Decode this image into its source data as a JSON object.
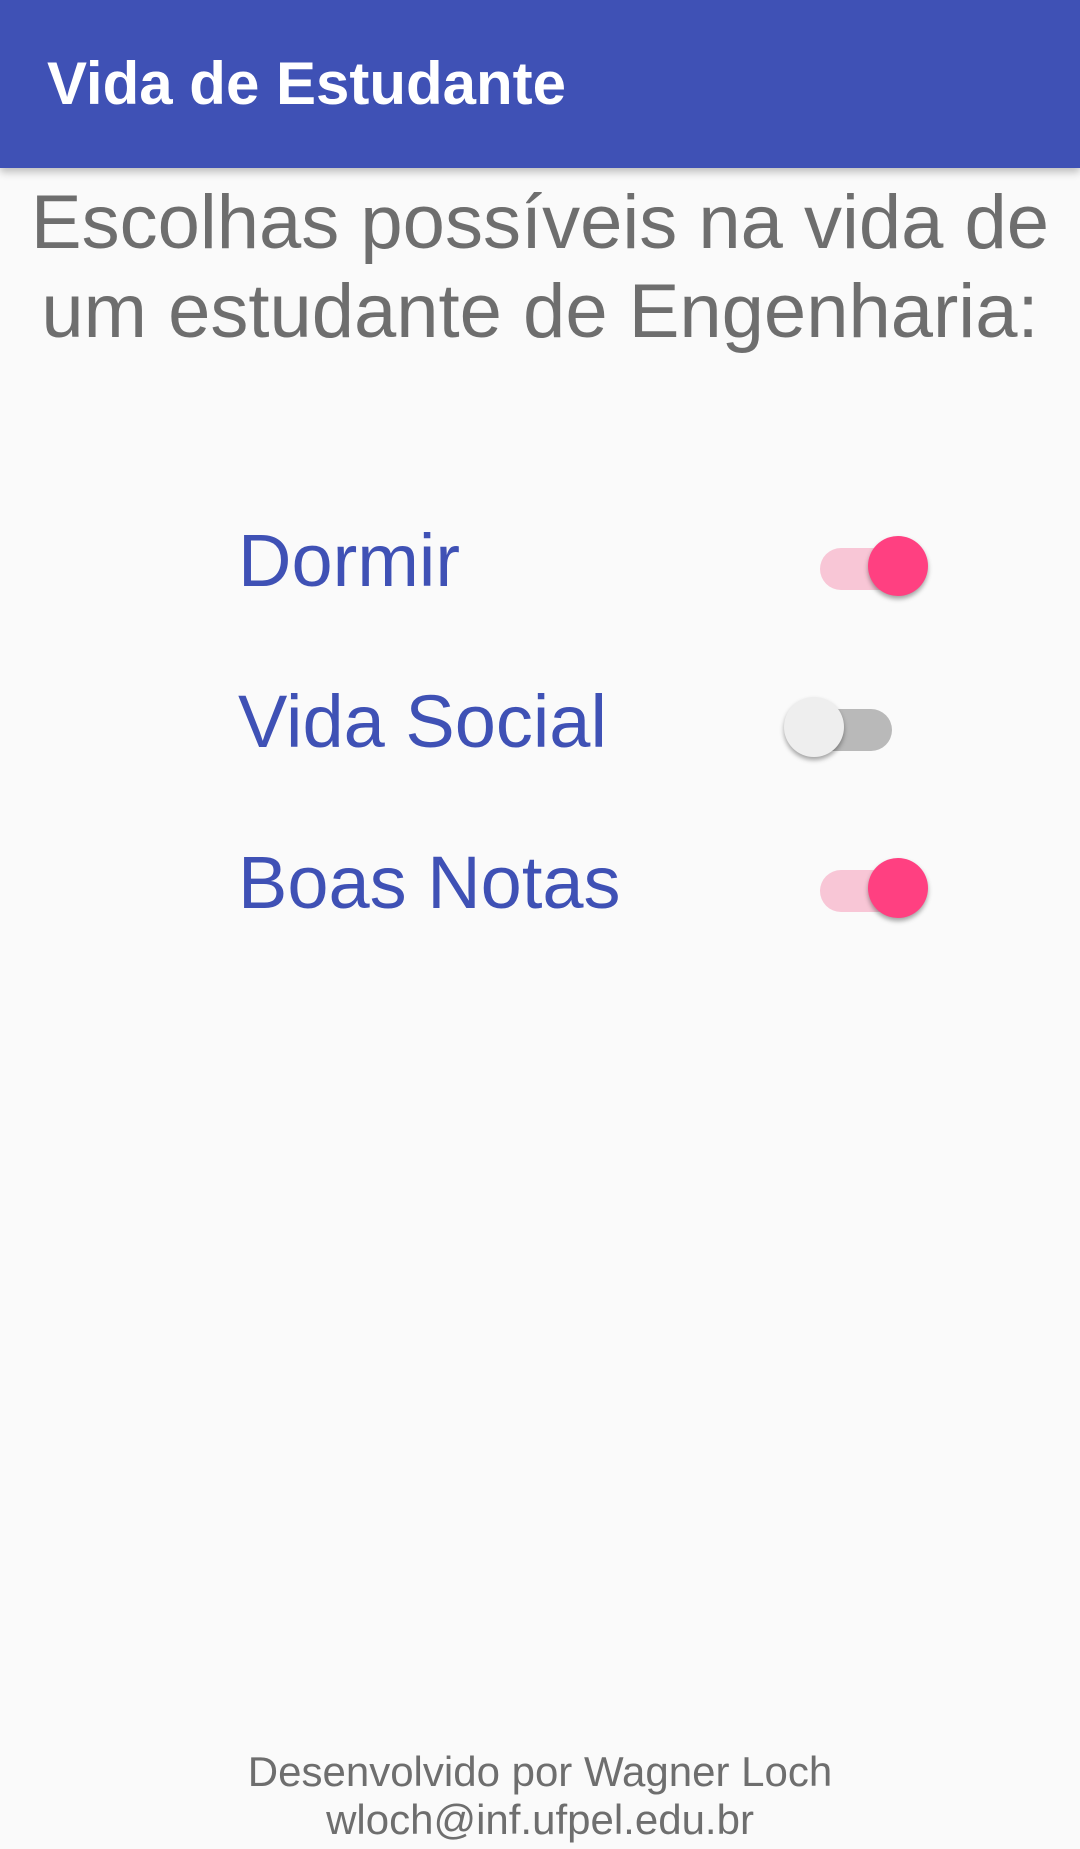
{
  "app_bar": {
    "title": "Vida de Estudante",
    "color": "#3f51b5"
  },
  "heading": "Escolhas possíveis na vida de um estudante de Engenharia:",
  "options": [
    {
      "label": "Dormir",
      "checked": true
    },
    {
      "label": "Vida Social",
      "checked": false
    },
    {
      "label": "Boas Notas",
      "checked": true
    }
  ],
  "footer": {
    "line1": "Desenvolvido por Wagner Loch",
    "line2": "wloch@inf.ufpel.edu.br"
  },
  "colors": {
    "accent": "#ff4081",
    "label": "#3f51b5",
    "text_secondary": "#6e6e6e"
  }
}
